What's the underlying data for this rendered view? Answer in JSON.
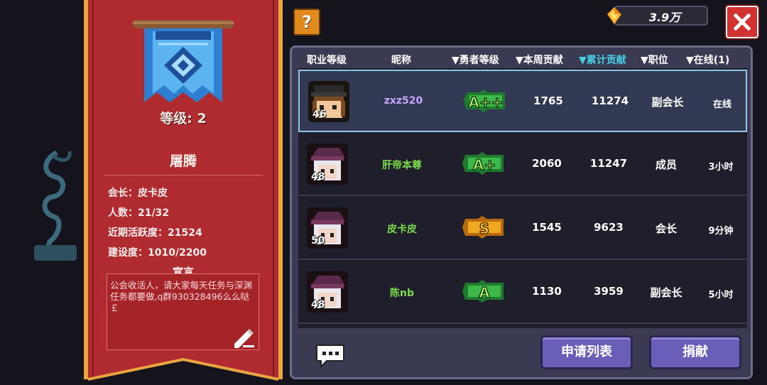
{
  "guild": {
    "level_text": "等级: 2",
    "name": "屠腾",
    "leader": "会长：皮卡皮",
    "members": "人数：21/32",
    "activity": "近期活跃度：21524",
    "construction": "建设度：1010/2200",
    "declaration_title": "宣言",
    "declaration": "公会收活人，请大家每天任务与深渊任务都要做,q群930328496么么哒￡"
  },
  "topbar": {
    "help_label": "?",
    "currency_value": "3.9万",
    "currency_icon": "gem-icon",
    "close_icon": "close-icon"
  },
  "columns": {
    "job_level": "职业等级",
    "nickname": "昵称",
    "hero_level": "▼勇者等级",
    "weekly": "▼本周贡献",
    "total": "▼累计贡献",
    "position": "▼职位",
    "online": "▼在线(1)"
  },
  "members": [
    {
      "level": "46",
      "nickname": "zxz520",
      "rank": "A++",
      "weekly": "1765",
      "total": "11274",
      "position": "副会长",
      "online": "在线",
      "nick_color": "#c9a6ff"
    },
    {
      "level": "48",
      "nickname": "肝帝本尊",
      "rank": "A+",
      "weekly": "2060",
      "total": "11247",
      "position": "成员",
      "online": "3小时",
      "nick_color": "#7ddc4c"
    },
    {
      "level": "50",
      "nickname": "皮卡皮",
      "rank": "S",
      "weekly": "1545",
      "total": "9623",
      "position": "会长",
      "online": "9分钟",
      "nick_color": "#7ddc4c"
    },
    {
      "level": "48",
      "nickname": "陈nb",
      "rank": "A",
      "weekly": "1130",
      "total": "3959",
      "position": "副会长",
      "online": "5小时",
      "nick_color": "#7ddc4c"
    }
  ],
  "buttons": {
    "apply_list": "申请列表",
    "donate": "捐献",
    "chat_icon": "chat-icon"
  }
}
